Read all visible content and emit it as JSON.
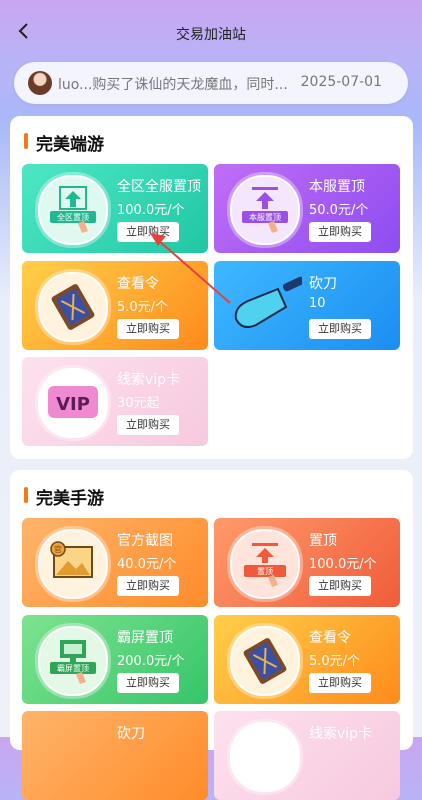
{
  "header": {
    "title": "交易加油站",
    "back_label": "‹"
  },
  "notice": {
    "message": "luo...购买了诛仙的天龙魔血，同时...",
    "date": "2025-07-01"
  },
  "sections": [
    {
      "title": "完美端游",
      "items": [
        {
          "name": "全区全服置顶",
          "price": "100.0元/个",
          "button": "立即购买",
          "icon": "top-all-icon",
          "icon_text": "全区置顶"
        },
        {
          "name": "本服置顶",
          "price": "50.0元/个",
          "button": "立即购买",
          "icon": "top-server-icon",
          "icon_text": "本服置顶"
        },
        {
          "name": "查看令",
          "price": "5.0元/个",
          "button": "立即购买",
          "icon": "view-token-icon"
        },
        {
          "name": "砍刀",
          "price": "10",
          "button": "立即购买",
          "icon": "cleaver-icon"
        },
        {
          "name": "线索vip卡",
          "price": "30元起",
          "button": "立即购买",
          "icon": "vip-icon",
          "icon_text": "VIP"
        }
      ]
    },
    {
      "title": "完美手游",
      "items": [
        {
          "name": "官方截图",
          "price": "40.0元/个",
          "button": "立即购买",
          "icon": "screenshot-icon",
          "icon_text": "官"
        },
        {
          "name": "置顶",
          "price": "100.0元/个",
          "button": "立即购买",
          "icon": "top-icon",
          "icon_text": "置顶"
        },
        {
          "name": "霸屏置顶",
          "price": "200.0元/个",
          "button": "立即购买",
          "icon": "screen-top-icon",
          "icon_text": "霸屏置顶"
        },
        {
          "name": "查看令",
          "price": "5.0元/个",
          "button": "立即购买",
          "icon": "view-token-icon"
        },
        {
          "name": "砍刀",
          "price": "",
          "button": "",
          "icon": "cleaver-icon"
        },
        {
          "name": "线索vip卡",
          "price": "",
          "button": "",
          "icon": "vip-icon"
        }
      ]
    }
  ]
}
